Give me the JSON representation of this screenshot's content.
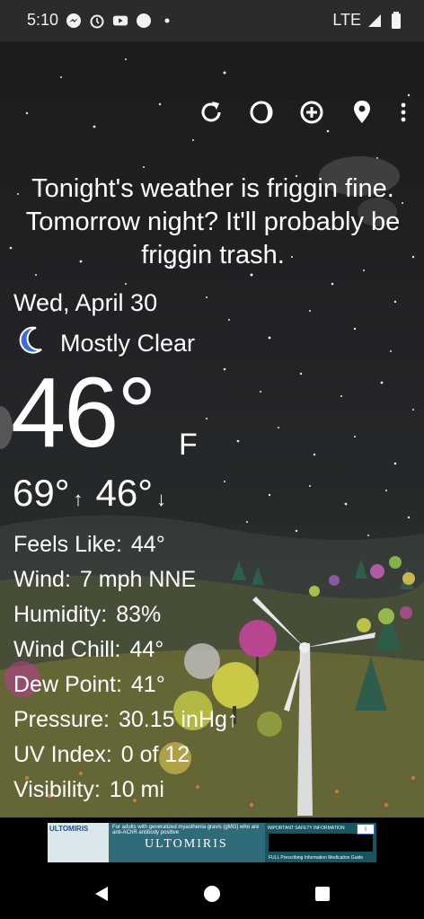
{
  "status_bar": {
    "time": "5:10",
    "network": "LTE",
    "icons": [
      "messenger-icon",
      "alarm-icon",
      "youtube-icon",
      "circle-icon",
      "dot-icon",
      "signal-icon",
      "battery-icon"
    ]
  },
  "toolbar": {
    "icons": [
      "refresh-icon",
      "theme-icon",
      "add-icon",
      "location-icon",
      "more-icon"
    ]
  },
  "headline": "Tonight's weather is friggin fine. Tomorrow night? It'll probably be friggin trash.",
  "date": "Wed, April 30",
  "condition": "Mostly Clear",
  "temperature": {
    "current": "46°",
    "unit": "F",
    "high": "69°",
    "low": "46°"
  },
  "details": [
    {
      "label": "Feels Like:",
      "value": "44°"
    },
    {
      "label": "Wind:",
      "value": "7 mph NNE"
    },
    {
      "label": "Humidity:",
      "value": "83%"
    },
    {
      "label": "Wind Chill:",
      "value": "44°"
    },
    {
      "label": "Dew Point:",
      "value": "41°"
    },
    {
      "label": "Pressure:",
      "value": "30.15 inHg↑"
    },
    {
      "label": "UV Index:",
      "value": "0 of 12"
    },
    {
      "label": "Visibility:",
      "value": "10 mi"
    }
  ],
  "ad": {
    "logo_text": "ULTOMIRIS",
    "brand": "ULTOMIRIS",
    "tagline": "For adults with generalized myasthenia gravis (gMG) who are anti-AChR antibody positive",
    "safety_title": "IMPORTANT SAFETY INFORMATION",
    "footer_links": "FULL Prescribing Information    Medication Guide"
  },
  "nav_bar": {
    "icons": [
      "back-icon",
      "home-icon",
      "recents-icon"
    ]
  },
  "colors": {
    "status_bar_bg": "#2b2b2b",
    "sky": "#1c1c1c",
    "text": "#ffffff",
    "moon": "#3b6fd1"
  }
}
